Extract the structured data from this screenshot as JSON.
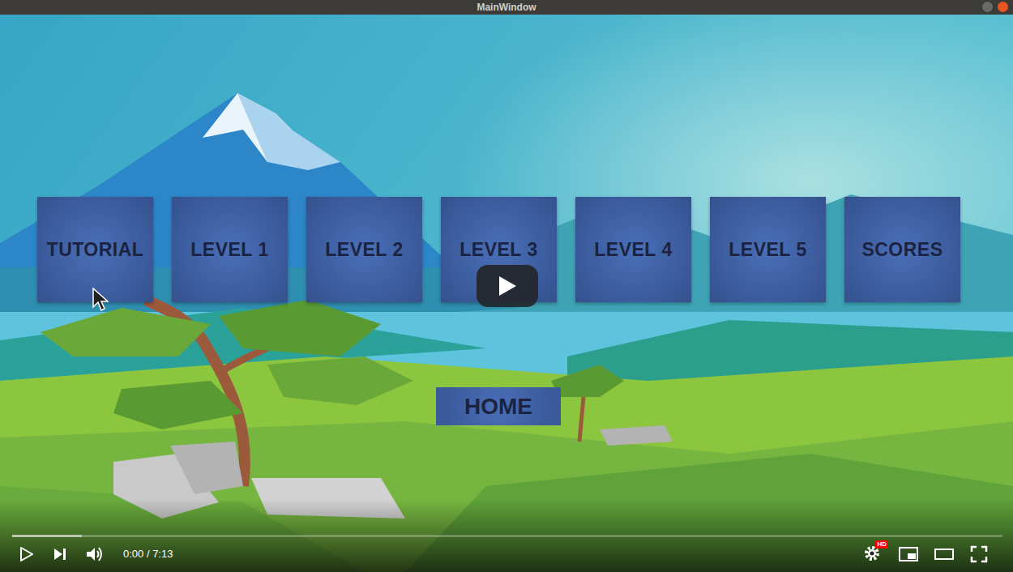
{
  "window": {
    "title": "MainWindow"
  },
  "menu": {
    "buttons": [
      {
        "label": "TUTORIAL"
      },
      {
        "label": "LEVEL 1"
      },
      {
        "label": "LEVEL 2"
      },
      {
        "label": "LEVEL 3"
      },
      {
        "label": "LEVEL 4"
      },
      {
        "label": "LEVEL 5"
      },
      {
        "label": "SCORES"
      }
    ],
    "home": "HOME"
  },
  "player": {
    "time": "0:00 / 7:13",
    "progress": 0,
    "buffered": 0.07,
    "hd_badge": "HD"
  }
}
